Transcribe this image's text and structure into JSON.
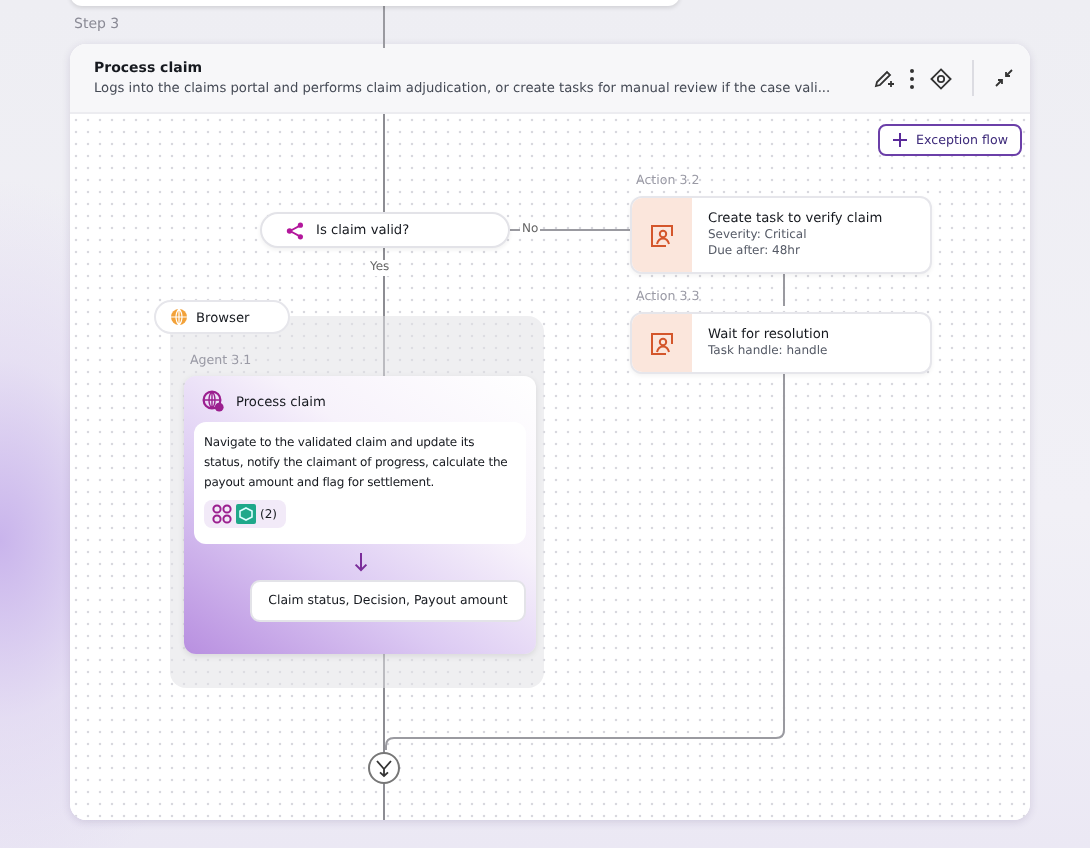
{
  "step_label": "Step 3",
  "step": {
    "title": "Process claim",
    "description": "Logs into the claims portal and performs claim adjudication, or create tasks for manual review if the case vali..."
  },
  "exception_button": {
    "label": "Exception flow"
  },
  "decision": {
    "label": "Is claim valid?",
    "no_label": "No",
    "yes_label": "Yes"
  },
  "actions": [
    {
      "label": "Action 3.2",
      "title": "Create task to verify claim",
      "details": [
        "Severity: Critical",
        "Due after: 48hr"
      ]
    },
    {
      "label": "Action 3.3",
      "title": "Wait for resolution",
      "details": [
        "Task handle: handle"
      ]
    }
  ],
  "tool_tag": {
    "label": "Browser"
  },
  "agent": {
    "label": "Agent 3.1",
    "title": "Process claim",
    "instructions": "Navigate to the validated claim and update its status, notify the claimant of progress, calculate the payout amount and flag for settlement.",
    "tools_count": "(2)",
    "outputs": "Claim status, Decision, Payout amount"
  }
}
